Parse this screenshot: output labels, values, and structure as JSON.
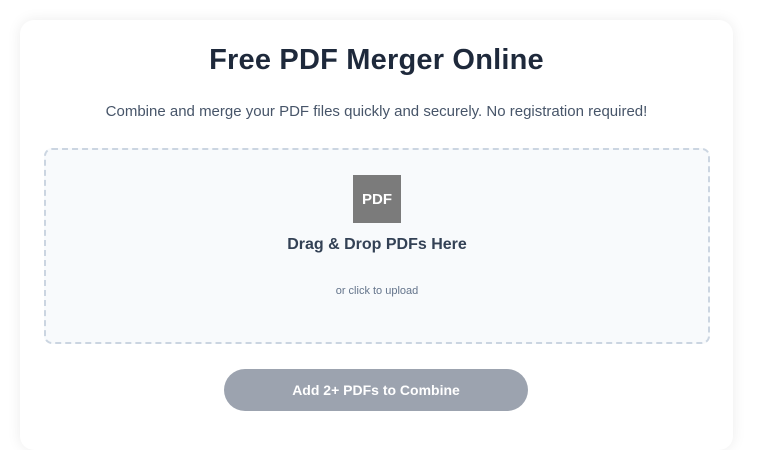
{
  "header": {
    "title": "Free PDF Merger Online",
    "subtitle": "Combine and merge your PDF files quickly and securely. No registration required!"
  },
  "dropzone": {
    "icon_label": "PDF",
    "title": "Drag & Drop PDFs Here",
    "hint": "or click to upload"
  },
  "actions": {
    "combine_label": "Add 2+ PDFs to Combine"
  },
  "colors": {
    "title": "#1e293b",
    "button_disabled": "#9ca3af",
    "icon_bg": "#7b7b7b",
    "dropzone_border": "#cbd5e1"
  }
}
